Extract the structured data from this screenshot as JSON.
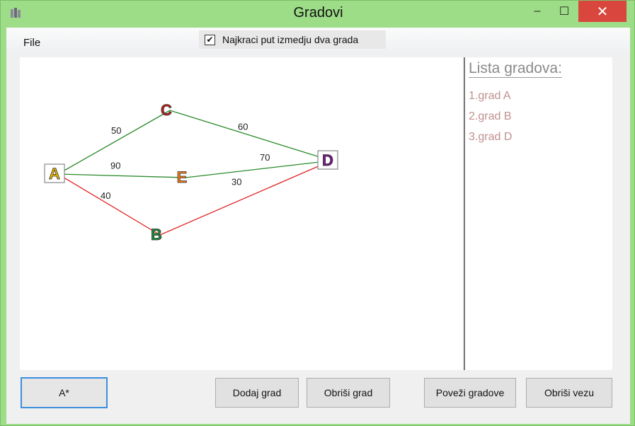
{
  "window": {
    "title": "Gradovi"
  },
  "controls": {
    "minimize": "–",
    "maximize": "☐",
    "close": "✕"
  },
  "menu": {
    "file": "File"
  },
  "toggle": {
    "label": "Najkraci put izmedju dva grada",
    "checked": true,
    "check_glyph": "✔"
  },
  "graph": {
    "nodes": [
      {
        "id": "A",
        "label": "A",
        "color": "#e8b400",
        "boxed": true
      },
      {
        "id": "C",
        "label": "C",
        "color": "#c0201a",
        "boxed": false
      },
      {
        "id": "E",
        "label": "E",
        "color": "#f07a18",
        "boxed": false
      },
      {
        "id": "B",
        "label": "B",
        "color": "#1e8a3a",
        "boxed": false
      },
      {
        "id": "D",
        "label": "D",
        "color": "#7a1a8a",
        "boxed": true
      }
    ],
    "edges": [
      {
        "from": "A",
        "to": "C",
        "weight": "50",
        "color": "#2a8a2a"
      },
      {
        "from": "C",
        "to": "D",
        "weight": "60",
        "color": "#2a8a2a"
      },
      {
        "from": "A",
        "to": "E",
        "weight": "90",
        "color": "#2a8a2a"
      },
      {
        "from": "E",
        "to": "D",
        "weight": "70",
        "color": "#2a8a2a"
      },
      {
        "from": "A",
        "to": "B",
        "weight": "40",
        "color": "#e02020"
      },
      {
        "from": "B",
        "to": "D",
        "weight": "30",
        "color": "#e02020"
      }
    ]
  },
  "list": {
    "title": "Lista gradova:",
    "items": [
      "1.grad A",
      "2.grad B",
      "3.grad D"
    ]
  },
  "buttons": {
    "astar": "A*",
    "add_city": "Dodaj grad",
    "delete_city": "Obriši grad",
    "connect_cities": "Poveži gradove",
    "delete_connection": "Obriši vezu"
  }
}
